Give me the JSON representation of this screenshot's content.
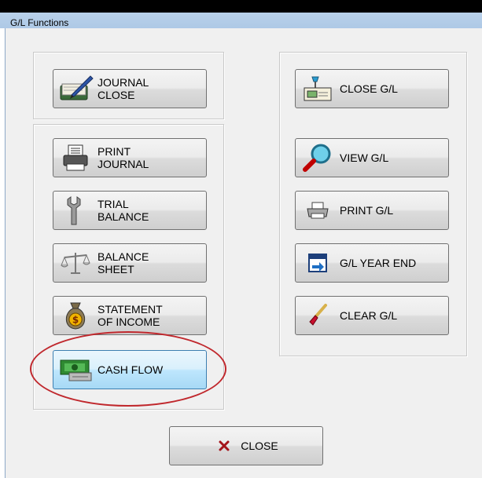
{
  "window": {
    "title": "G/L Functions"
  },
  "left_buttons": {
    "journal_close": "JOURNAL\nCLOSE",
    "print_journal": "PRINT\nJOURNAL",
    "trial_balance": "TRIAL\nBALANCE",
    "balance_sheet": "BALANCE\nSHEET",
    "statement_of_income": "STATEMENT\nOF INCOME",
    "cash_flow": "CASH FLOW"
  },
  "right_buttons": {
    "close_gl": "CLOSE G/L",
    "view_gl": "VIEW G/L",
    "print_gl": "PRINT G/L",
    "gl_year_end": "G/L YEAR END",
    "clear_gl": "CLEAR G/L"
  },
  "footer": {
    "close": "CLOSE"
  },
  "annotation_color": "#c0282d",
  "icons": {
    "journal_close": "journal-quill-icon",
    "print_journal": "printer-icon",
    "trial_balance": "wrench-icon",
    "balance_sheet": "scales-icon",
    "statement_of_income": "money-bag-icon",
    "cash_flow": "money-bill-icon",
    "close_gl": "desk-lamp-icon",
    "view_gl": "magnifier-icon",
    "print_gl": "small-printer-icon",
    "gl_year_end": "calendar-arrow-icon",
    "clear_gl": "paint-brush-icon",
    "close": "red-x-icon"
  }
}
